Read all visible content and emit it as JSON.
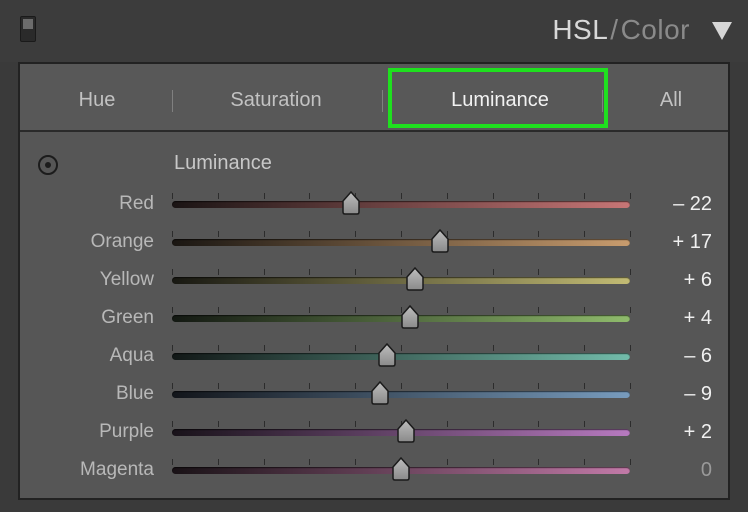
{
  "header": {
    "title_main": "HSL",
    "title_sep": "/",
    "title_sub": "Color"
  },
  "tabs": [
    {
      "label": "Hue"
    },
    {
      "label": "Saturation"
    },
    {
      "label": "Luminance"
    },
    {
      "label": "All"
    }
  ],
  "active_tab": "Luminance",
  "section": {
    "title": "Luminance",
    "target_icon": "target-adjustment-icon"
  },
  "sliders": [
    {
      "label": "Red",
      "value": -22,
      "display": "– 22",
      "color_left": "#1a1414",
      "color_right": "#c87676"
    },
    {
      "label": "Orange",
      "value": 17,
      "display": "+ 17",
      "color_left": "#1a1612",
      "color_right": "#c89c6e"
    },
    {
      "label": "Yellow",
      "value": 6,
      "display": "+ 6",
      "color_left": "#181812",
      "color_right": "#c2bb74"
    },
    {
      "label": "Green",
      "value": 4,
      "display": "+ 4",
      "color_left": "#131812",
      "color_right": "#8fbb6c"
    },
    {
      "label": "Aqua",
      "value": -6,
      "display": "– 6",
      "color_left": "#121817",
      "color_right": "#72bcaa"
    },
    {
      "label": "Blue",
      "value": -9,
      "display": "– 9",
      "color_left": "#12151a",
      "color_right": "#789cbe"
    },
    {
      "label": "Purple",
      "value": 2,
      "display": "+ 2",
      "color_left": "#181219",
      "color_right": "#b77ac0"
    },
    {
      "label": "Magenta",
      "value": 0,
      "display": "0",
      "color_left": "#191216",
      "color_right": "#c27aa8"
    }
  ],
  "slider_range": [
    -100,
    100
  ],
  "highlight_color": "#1fe01f"
}
